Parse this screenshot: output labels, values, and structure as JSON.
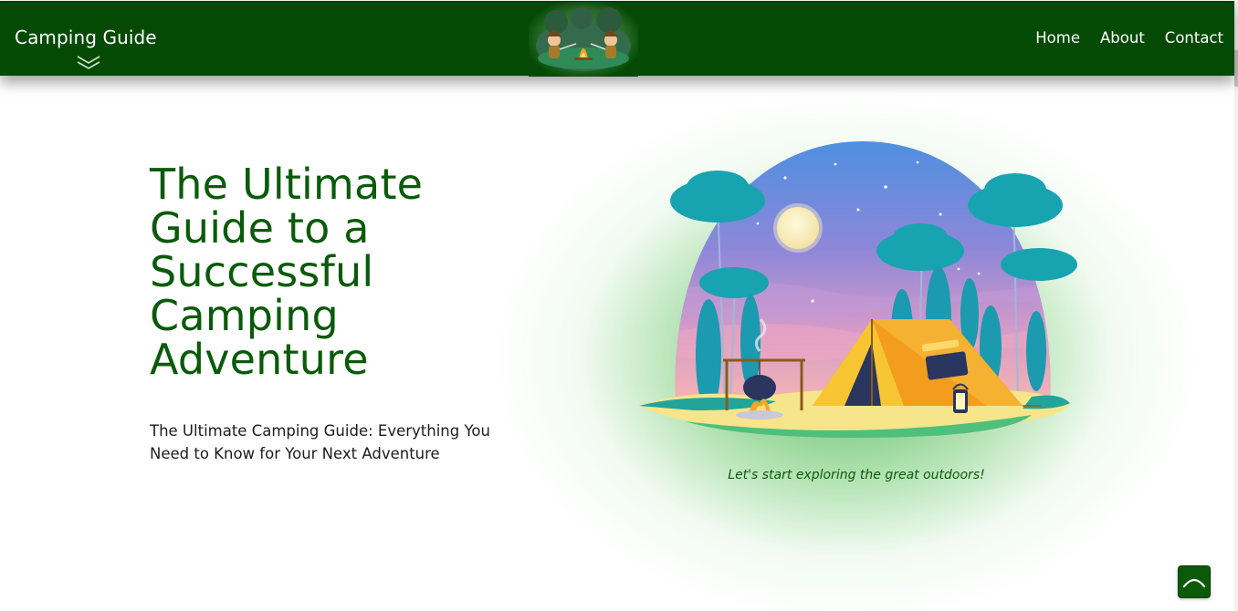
{
  "header": {
    "brand": "Camping Guide",
    "nav": [
      {
        "label": "Home"
      },
      {
        "label": "About"
      },
      {
        "label": "Contact"
      }
    ]
  },
  "hero": {
    "title": "The Ultimate Guide to a Successful Camping Adventure",
    "subtitle": "The Ultimate Camping Guide: Everything You Need to Know for Your Next Adventure",
    "caption": "Let's start exploring the great outdoors!"
  },
  "icons": {
    "brand_toggle": "chevron-double-down-icon",
    "back_to_top": "chevron-up-icon"
  },
  "colors": {
    "header_bg": "#044a04",
    "title_color": "#0a5a0a",
    "accent_glow": "#36aa3a"
  }
}
